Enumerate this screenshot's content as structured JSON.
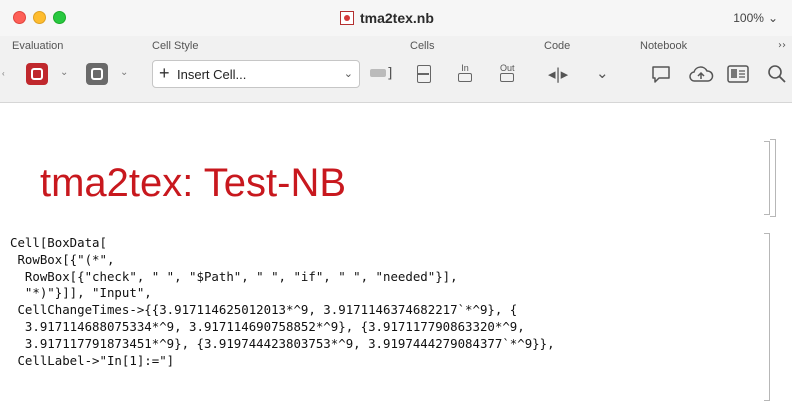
{
  "window": {
    "title": "tma2tex.nb",
    "zoom": "100%",
    "zoom_chevron": "⌄"
  },
  "toolbar": {
    "groups": {
      "evaluation": "Evaluation",
      "cell_style": "Cell Style",
      "cells": "Cells",
      "code": "Code",
      "notebook": "Notebook"
    },
    "insert_cell_label": "Insert Cell...",
    "in_label": "In",
    "out_label": "Out"
  },
  "notebook": {
    "title_cell": "tma2tex: Test-NB",
    "code_lines": [
      "Cell[BoxData[",
      " RowBox[{\"(*\",",
      "  RowBox[{\"check\", \" \", \"$Path\", \" \", \"if\", \" \", \"needed\"}],",
      "  \"*)\"}]], \"Input\",",
      " CellChangeTimes->{{3.917114625012013*^9, 3.9171146374682217`*^9}, {",
      "  3.917114688075334*^9, 3.917114690758852*^9}, {3.917117790863320*^9,",
      "  3.917117791873451*^9}, {3.919744423803753*^9, 3.9197444279084377`*^9}},",
      " CellLabel->\"In[1]:=\"]"
    ]
  },
  "icons": {
    "notebook_file": "notebook-file-icon",
    "evaluate": "gear-icon",
    "comment": "speech-bubble-icon",
    "cloud": "cloud-upload-icon",
    "image": "picture-icon",
    "search": "search-icon"
  },
  "colors": {
    "title_red": "#c8181e",
    "eval_red": "#c0282d"
  }
}
